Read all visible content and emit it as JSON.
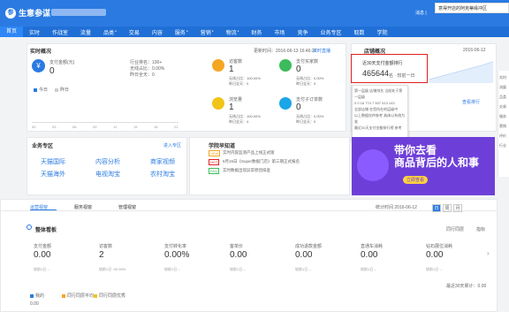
{
  "app": {
    "logo_text": "生意参谋",
    "logo_mark": "参"
  },
  "tooltip_top": "意得开店的阿克蒂缘冲区",
  "header_right": "消息 |",
  "nav": {
    "items": [
      "首页",
      "实时",
      "作战室",
      "流量",
      "品类",
      "交易",
      "内容",
      "服务",
      "营销",
      "物流",
      "财务",
      "市场",
      "竞争",
      "业务专区",
      "取数",
      "学院"
    ],
    "active": 0
  },
  "realtime": {
    "title": "实时概况",
    "updated": "更新时间：2016-06-13 16:46:27",
    "link": "实时直播",
    "pay_label": "支付金额(元)",
    "pay_value": "0",
    "side_stats": [
      "行业排名：100+",
      "无线占比：0.00%",
      "昨日全天：0"
    ],
    "legend_today": "今日",
    "legend_yesterday": "昨日",
    "x_ticks": [
      "00",
      "03",
      "06",
      "09",
      "12",
      "15",
      "18",
      "21"
    ],
    "metrics": [
      {
        "label": "访客数",
        "value": "1",
        "icon": "person-icon",
        "color": "#f5a623",
        "sub": [
          "无线占比：100.00%",
          "昨日全天：0"
        ]
      },
      {
        "label": "支付买家数",
        "value": "0",
        "icon": "buyer-icon",
        "color": "#3dbb5c",
        "sub": [
          "无线占比：0.00%",
          "昨日全天：0"
        ]
      },
      {
        "label": "浏览量",
        "value": "1",
        "icon": "eye-icon",
        "color": "#f0c419",
        "sub": [
          "无线占比：100.00%",
          "昨日全天：4"
        ]
      },
      {
        "label": "支付子订单数",
        "value": "0",
        "icon": "order-icon",
        "color": "#1aa6e8",
        "sub": [
          "无线占比：0.00%",
          "昨日全天：0"
        ]
      }
    ]
  },
  "ranking": {
    "title": "店铺概况",
    "date": "2016-06-12",
    "rank_label": "近30天支付金额排行",
    "rank_value": "465644",
    "rank_suffix": "名 · 较前一日",
    "tier": "第一层级",
    "popup_lines": [
      "第一层级 店铺排名 当前处于第一层级",
      "0 0 16 774 7 507 513 143",
      "全部店铺 在您所在的层级中",
      "以上数据仅供参考 具体以系统为准",
      "最近30天支付金额排行榜 参考"
    ],
    "link": "查看排行"
  },
  "business": {
    "title": "业务专区",
    "more": "进入专区",
    "links": [
      "天猫国际",
      "内容分析",
      "商家视频",
      "天猫海外",
      "电视淘宝",
      "农村淘宝"
    ]
  },
  "learning": {
    "title": "学院早知道",
    "items": [
      {
        "tag": "NEW",
        "text": "实时内容监测产品上线正式版"
      },
      {
        "tag": "HOT",
        "text": "6月15日《Super数据门店》第三期正式报名"
      },
      {
        "tag": "FAQ",
        "text": "实时数据出现异常原因排查"
      }
    ]
  },
  "banner": {
    "line1": "带你去看",
    "line2": "商品背后的人和事",
    "btn": "立即查看"
  },
  "panel": {
    "tabs": [
      "运营视窗",
      "服务视窗",
      "管理视窗"
    ],
    "stat_date_label": "统计时间 2016-06-12",
    "period_tabs": [
      "日",
      "周",
      "月"
    ],
    "section_title": "整体看板",
    "toggles": [
      "同行同层",
      "指标"
    ],
    "metrics": [
      {
        "t": "支付金额",
        "v": "0.00",
        "s": "较前1日 --"
      },
      {
        "t": "访客数",
        "v": "2",
        "s": "较前1日 -90.90%"
      },
      {
        "t": "支付转化率",
        "v": "0.00%",
        "s": "较前1日 --"
      },
      {
        "t": "客单价",
        "v": "0.00",
        "s": "较前1日 --"
      },
      {
        "t": "成功退款金额",
        "v": "0.00",
        "s": "较前1日 --"
      },
      {
        "t": "直通车消耗",
        "v": "0.00",
        "s": "较前1日 --"
      },
      {
        "t": "钻石展位消耗",
        "v": "0.00",
        "s": "较前1日 --"
      }
    ],
    "bottom_legend": [
      "我的",
      "同行同层平均",
      "同行同层优秀"
    ],
    "bottom_right": "最近30天累计：0.00",
    "bottom_value": "0.00"
  },
  "right_sidebar": [
    "实时",
    "流量",
    "品类",
    "交易",
    "服务",
    "营销",
    "评价",
    "行业"
  ],
  "colors": {
    "brand": "#2a7ae2",
    "highlight": "#e02020"
  }
}
